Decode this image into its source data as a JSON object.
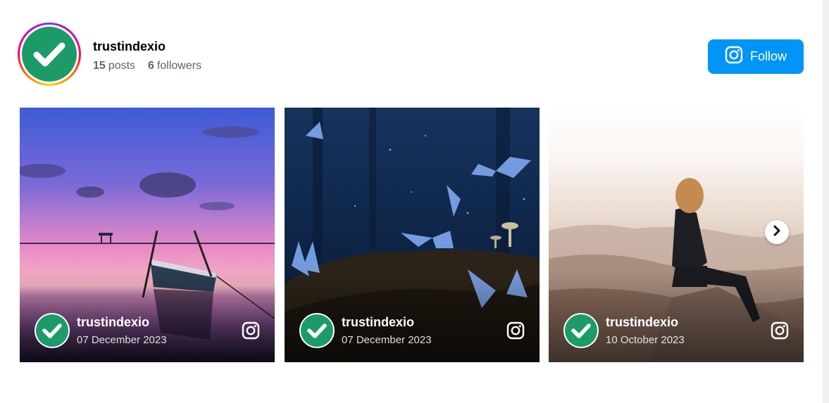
{
  "profile": {
    "username": "trustindexio",
    "posts_count": "15",
    "posts_label": "posts",
    "followers_count": "6",
    "followers_label": "followers",
    "avatar_icon": "check-icon"
  },
  "follow_button": {
    "label": "Follow",
    "icon": "instagram-icon"
  },
  "posts": [
    {
      "author": "trustindexio",
      "date": "07 December 2023",
      "image": "sunset-boat-lake"
    },
    {
      "author": "trustindexio",
      "date": "07 December 2023",
      "image": "blue-butterflies-forest"
    },
    {
      "author": "trustindexio",
      "date": "10 October 2023",
      "image": "woman-sitting-on-mountain"
    }
  ],
  "carousel": {
    "next_icon": "chevron-right-icon"
  },
  "colors": {
    "brand_green": "#1c9b68",
    "follow_blue": "#0095f6",
    "stats_gray": "#5a6470"
  }
}
